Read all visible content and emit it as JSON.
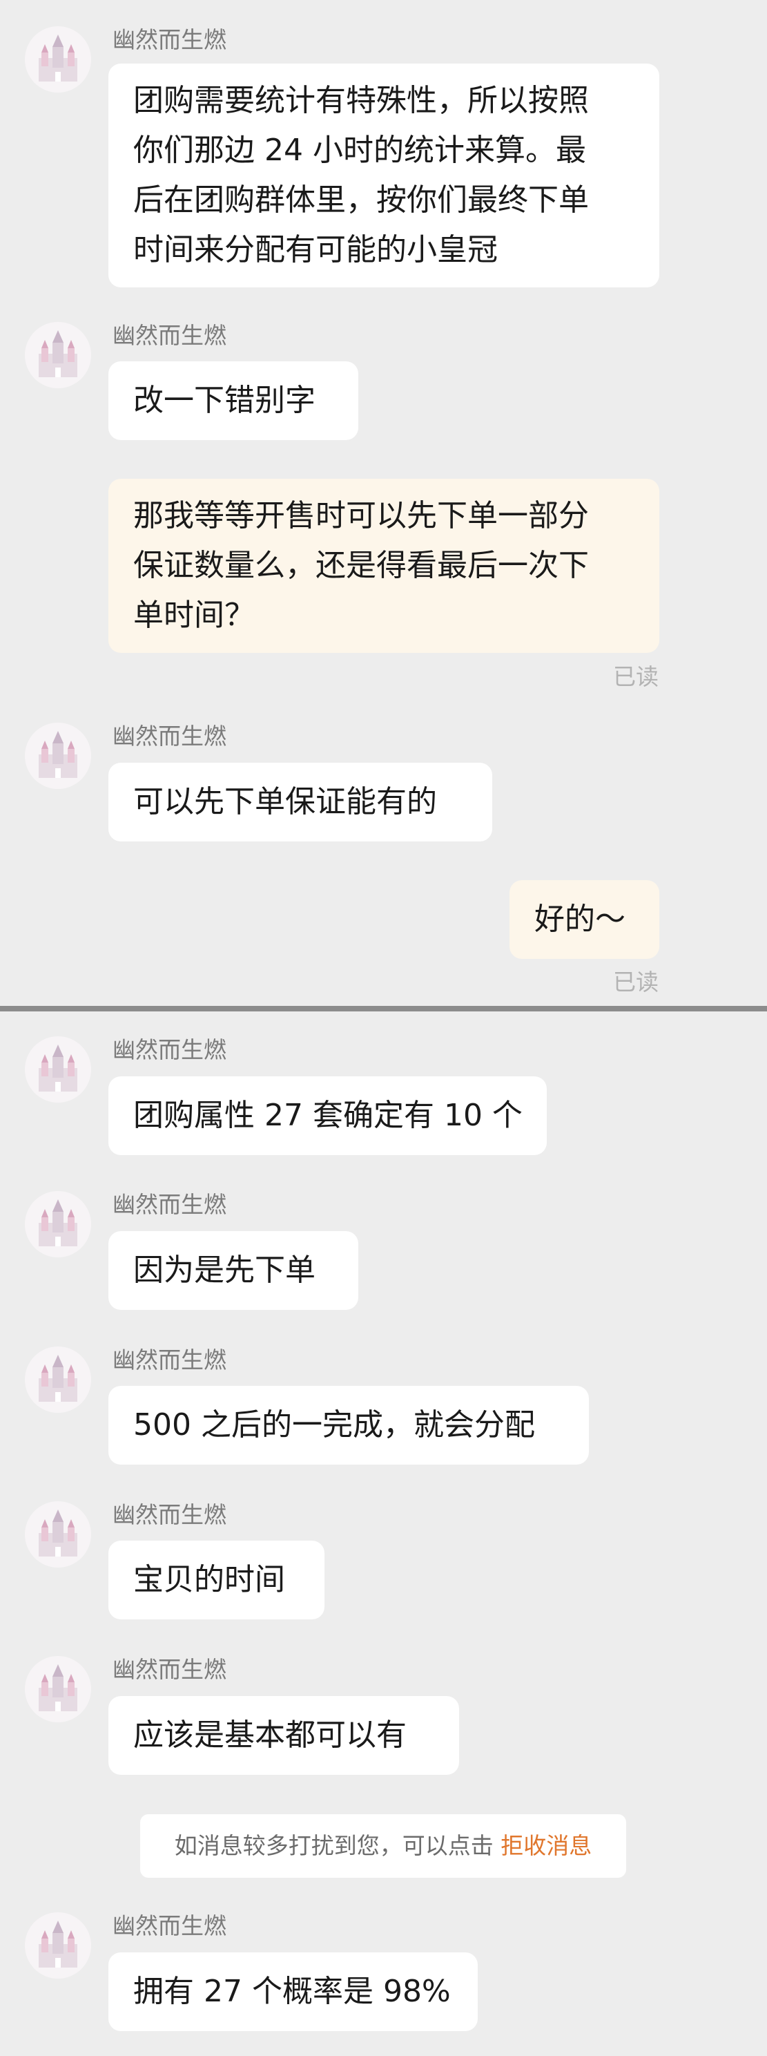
{
  "sender_name": "幽然而生燃",
  "read_status": "已读",
  "messages": [
    {
      "text_lines": [
        "团购需要统计有特殊性，所以按照",
        "你们那边 24 小时的统计来算。最",
        "后在团购群体里，按你们最终下单",
        "时间来分配有可能的小皇冠"
      ]
    },
    {
      "text": "改一下错别字"
    },
    {
      "text_lines": [
        "那我等等开售时可以先下单一部分",
        "保证数量么，还是得看最后一次下",
        "单时间？"
      ]
    },
    {
      "text": "可以先下单保证能有的"
    },
    {
      "text": "好的～"
    },
    {
      "text": "团购属性 27 套确定有 10 个"
    },
    {
      "text": "因为是先下单"
    },
    {
      "text": "500 之后的一完成，就会分配"
    },
    {
      "text": "宝贝的时间"
    },
    {
      "text": "应该是基本都可以有"
    },
    {
      "text": "拥有 27 个概率是 98%"
    }
  ],
  "notice": {
    "prefix": "如消息较多打扰到您，可以点击",
    "link": "拒收消息"
  },
  "colors": {
    "background": "#ededed",
    "own_bubble": "#fdf6ea",
    "other_bubble": "#ffffff",
    "link": "#e0762c"
  }
}
